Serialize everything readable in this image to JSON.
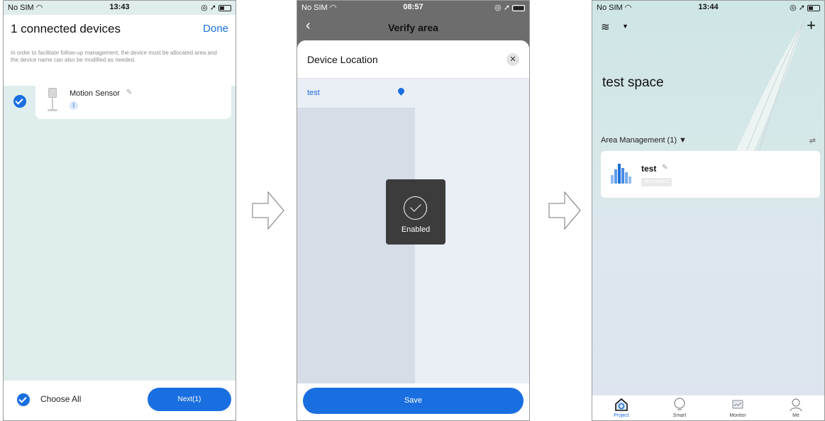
{
  "screen1": {
    "status": {
      "carrier": "No SIM",
      "time": "13:43"
    },
    "title": "1 connected devices",
    "done_label": "Done",
    "description": "In order to facilitate follow-up management, the device must be allocated area and the device name can also be modified as needed.",
    "device": {
      "name": "Motion Sensor",
      "connection_icon": "bluetooth-icon"
    },
    "choose_all_label": "Choose All",
    "next_label": "Next(1)"
  },
  "screen2": {
    "status": {
      "carrier": "No SIM",
      "time": "08:57"
    },
    "nav_title": "Verify area",
    "sheet_title": "Device Location",
    "close_glyph": "✕",
    "selected_area": "test",
    "toast_label": "Enabled",
    "save_label": "Save"
  },
  "screen3": {
    "status": {
      "carrier": "No SIM",
      "time": "13:44"
    },
    "space_name": "test space",
    "area_management_label": "Area Management (1) ▼",
    "area": {
      "name": "test",
      "badge": "All Devices 1"
    },
    "tabs": [
      {
        "label": "Project",
        "icon": "project-icon",
        "active": true
      },
      {
        "label": "Smart",
        "icon": "bulb-icon",
        "active": false
      },
      {
        "label": "Monitor",
        "icon": "monitor-icon",
        "active": false
      },
      {
        "label": "Me",
        "icon": "user-icon",
        "active": false
      }
    ]
  },
  "colors": {
    "accent": "#1a6fe0",
    "toast_bg": "#3c3c3c"
  }
}
